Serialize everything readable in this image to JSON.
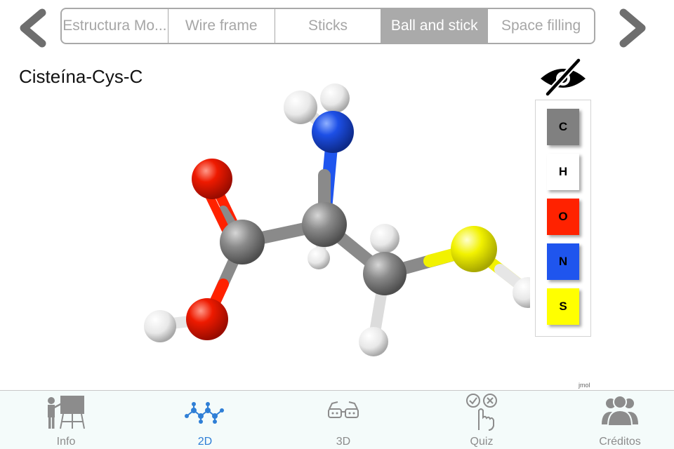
{
  "segments": {
    "items": [
      {
        "label": "Estructura Mo..."
      },
      {
        "label": "Wire frame"
      },
      {
        "label": "Sticks"
      },
      {
        "label": "Ball and stick"
      },
      {
        "label": "Space filling"
      }
    ],
    "selected_index": 3
  },
  "molecule": {
    "title": "Cisteína-Cys-C"
  },
  "legend": {
    "items": [
      {
        "label": "C",
        "color": "#808080"
      },
      {
        "label": "H",
        "color": "#ffffff"
      },
      {
        "label": "O",
        "color": "#ff2200"
      },
      {
        "label": "N",
        "color": "#1f55ee"
      },
      {
        "label": "S",
        "color": "#ffff00"
      }
    ]
  },
  "watermark": "jmol",
  "tabbar": {
    "items": [
      {
        "label": "Info",
        "icon": "teacher-board-icon"
      },
      {
        "label": "2D",
        "icon": "molecule-2d-icon"
      },
      {
        "label": "3D",
        "icon": "3d-glasses-icon"
      },
      {
        "label": "Quiz",
        "icon": "quiz-hand-icon"
      },
      {
        "label": "Créditos",
        "icon": "people-icon"
      }
    ],
    "active_index": 1
  },
  "colors": {
    "accent": "#2f7fd6",
    "inactive": "#8c8c8c",
    "segment_selected": "#aaaaaa"
  }
}
